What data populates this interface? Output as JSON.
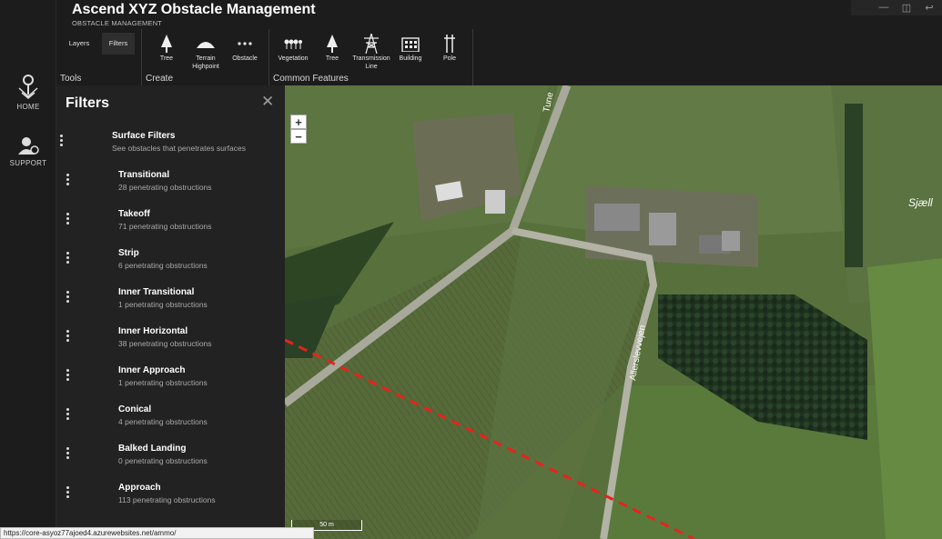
{
  "app": {
    "title": "Ascend XYZ Obstacle Management",
    "subtitle": "OBSTACLE MANAGEMENT"
  },
  "nav": {
    "home_label": "HOME",
    "support_label": "SUPPORT"
  },
  "ribbon": {
    "tools": {
      "label": "Tools",
      "tabs": [
        "Layers",
        "Filters"
      ],
      "active_tab": "Filters"
    },
    "create": {
      "label": "Create",
      "buttons": [
        "Tree",
        "Terrain Highpoint",
        "Obstacle"
      ]
    },
    "common": {
      "label": "Common Features",
      "buttons": [
        "Vegetation",
        "Tree",
        "Transmission Line",
        "Building",
        "Pole"
      ]
    }
  },
  "filters": {
    "title": "Filters",
    "surface": {
      "name": "Surface Filters",
      "description": "See obstacles that penetrates surfaces"
    },
    "items": [
      {
        "name": "Transitional",
        "description": "28 penetrating obstructions"
      },
      {
        "name": "Takeoff",
        "description": "71 penetrating obstructions"
      },
      {
        "name": "Strip",
        "description": "6 penetrating obstructions"
      },
      {
        "name": "Inner Transitional",
        "description": "1 penetrating obstructions"
      },
      {
        "name": "Inner Horizontal",
        "description": "38 penetrating obstructions"
      },
      {
        "name": "Inner Approach",
        "description": "1 penetrating obstructions"
      },
      {
        "name": "Conical",
        "description": "4 penetrating obstructions"
      },
      {
        "name": "Balked Landing",
        "description": "0 penetrating obstructions"
      },
      {
        "name": "Approach",
        "description": "113 penetrating obstructions"
      }
    ]
  },
  "map": {
    "zoom_in": "+",
    "zoom_out": "−",
    "scale_label": "50 m",
    "labels": {
      "road1": "Tune",
      "road2": "Allerslevvejen",
      "place": "Sjæll"
    }
  },
  "status_url": "https://core-asyoz77ajoed4.azurewebsites.net/ammo/",
  "colors": {
    "dashed_line": "#e8231c",
    "background": "#1c1c1c",
    "panel": "#222222"
  }
}
